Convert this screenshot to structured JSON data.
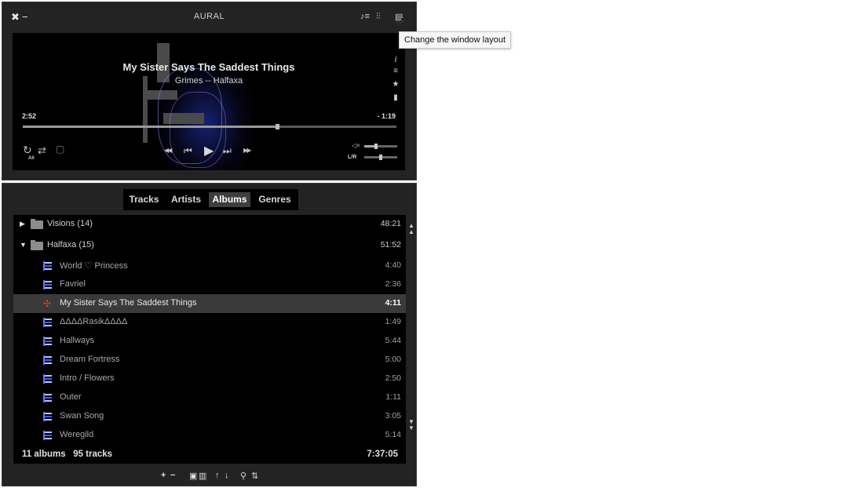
{
  "player": {
    "app_title": "AURAL",
    "close_icon": "✖",
    "minimize_icon": "−",
    "now_playing": {
      "title": "My Sister Says The Saddest Things",
      "subtitle": "Grimes -- Halfaxa",
      "elapsed": "2:52",
      "remaining": "- 1:19",
      "progress": 0.68
    },
    "side_icons": {
      "info": "i",
      "queue": "≡",
      "favorite": "★",
      "bookmark": "▮"
    },
    "controls": {
      "repeat_label": "All",
      "repeat": "↻",
      "shuffle": "⇄",
      "stop_after": "▢",
      "rewind": "◀◀",
      "previous": "⏮",
      "play": "▶",
      "next": "⏭",
      "fast_forward": "▶▶",
      "mute": "◁×",
      "balance_label": "L/R",
      "volume": 0.35,
      "balance": 0.5
    }
  },
  "tooltip": "Change the window layout",
  "playlist": {
    "tabs": [
      {
        "label": "Tracks"
      },
      {
        "label": "Artists"
      },
      {
        "label": "Albums"
      },
      {
        "label": "Genres"
      }
    ],
    "groups": [
      {
        "name": "Visions (14)",
        "duration": "48:21"
      },
      {
        "name": "Halfaxa (15)",
        "duration": "51:52"
      }
    ],
    "tracks": [
      {
        "name": "World ♡ Princess",
        "duration": "4:40"
      },
      {
        "name": "Favriel",
        "duration": "2:36"
      },
      {
        "name": "My Sister Says The Saddest Things",
        "duration": "4:11"
      },
      {
        "name": "ΔΔΔΔRasikΔΔΔΔ",
        "duration": "1:49"
      },
      {
        "name": "Hallways",
        "duration": "5:44"
      },
      {
        "name": "Dream Fortress",
        "duration": "5:00"
      },
      {
        "name": "Intro / Flowers",
        "duration": "2:50"
      },
      {
        "name": "Outer",
        "duration": "1:11"
      },
      {
        "name": "Swan Song",
        "duration": "3:05"
      },
      {
        "name": "Weregild",
        "duration": "5:14"
      }
    ],
    "summary": "11 albums   95 tracks",
    "total_duration": "7:37:05"
  }
}
